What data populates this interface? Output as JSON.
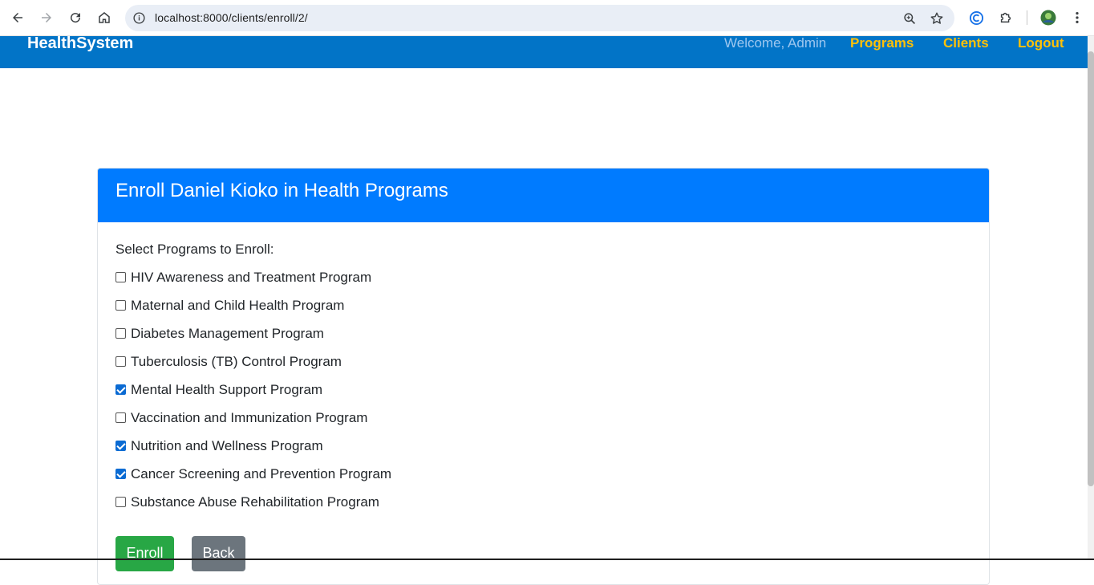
{
  "browser": {
    "url": "localhost:8000/clients/enroll/2/"
  },
  "navbar": {
    "brand": "HealthSystem",
    "welcome": "Welcome, Admin",
    "links": [
      "Programs",
      "Clients",
      "Logout"
    ]
  },
  "card": {
    "title": "Enroll Daniel Kioko in Health Programs",
    "label": "Select Programs to Enroll:",
    "programs": [
      {
        "name": "HIV Awareness and Treatment Program",
        "checked": false
      },
      {
        "name": "Maternal and Child Health Program",
        "checked": false
      },
      {
        "name": "Diabetes Management Program",
        "checked": false
      },
      {
        "name": "Tuberculosis (TB) Control Program",
        "checked": false
      },
      {
        "name": "Mental Health Support Program",
        "checked": true
      },
      {
        "name": "Vaccination and Immunization Program",
        "checked": false
      },
      {
        "name": "Nutrition and Wellness Program",
        "checked": true
      },
      {
        "name": "Cancer Screening and Prevention Program",
        "checked": true
      },
      {
        "name": "Substance Abuse Rehabilitation Program",
        "checked": false
      }
    ],
    "enroll_label": "Enroll",
    "back_label": "Back"
  },
  "colors": {
    "navbar": "#0274c7",
    "nav_link": "#ffc107",
    "card_header": "#007bff",
    "enroll": "#28a745",
    "back": "#6c757d"
  }
}
